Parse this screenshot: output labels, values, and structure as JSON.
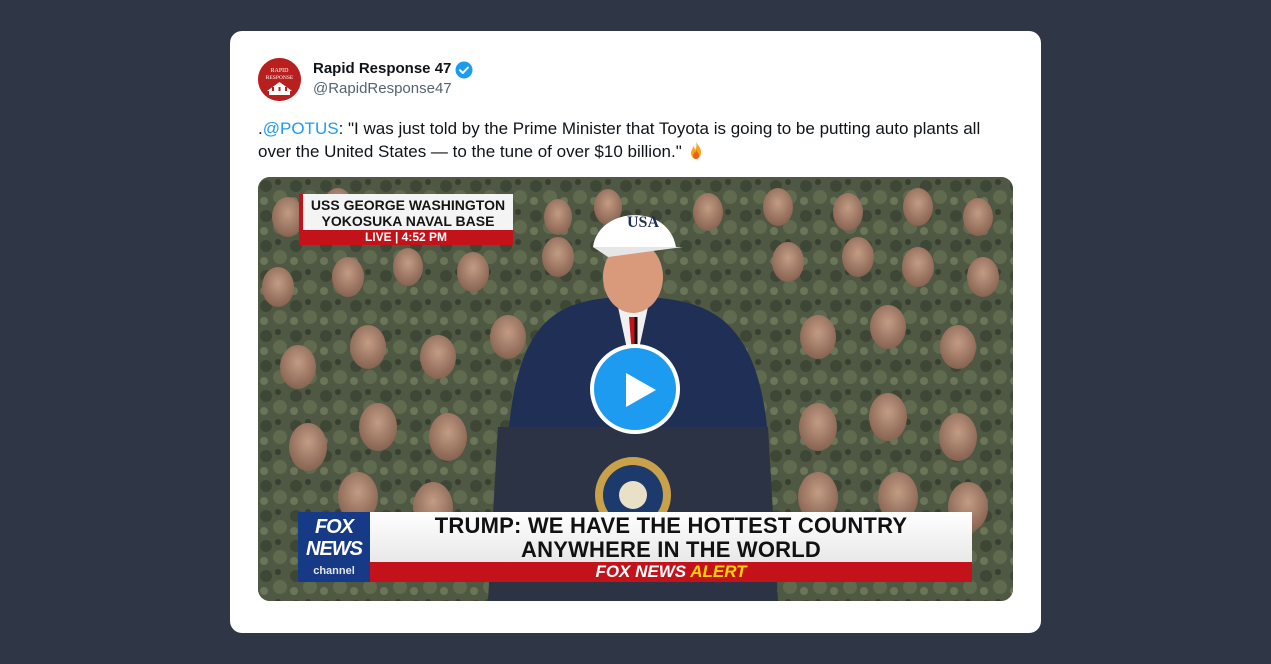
{
  "tweet": {
    "author": {
      "display_name": "Rapid Response 47",
      "handle": "@RapidResponse47",
      "avatar_text_line1": "RAPID",
      "avatar_text_line2": "RESPONSE",
      "verified": true
    },
    "text_prefix": ".",
    "mention": "@POTUS",
    "text_body": ": \"I was just told by the Prime Minister that Toyota is going to be putting auto plants all over the United States — to the tune of over $10 billion.\"",
    "emoji": "fire-emoji"
  },
  "video": {
    "location_line1": "USS GEORGE WASHINGTON",
    "location_line2": "YOKOSUKA NAVAL BASE",
    "live_label": "LIVE",
    "separator": "|",
    "time": "4:52 PM",
    "headline_line1": "TRUMP: WE HAVE THE HOTTEST COUNTRY",
    "headline_line2": "ANYWHERE IN THE WORLD",
    "alert_brand": "FOX NEWS",
    "alert_word": "ALERT",
    "logo_line1": "FOX",
    "logo_line2": "NEWS",
    "logo_line3": "channel",
    "cap_text": "USA",
    "play_icon": "play-icon"
  },
  "colors": {
    "background": "#2f3747",
    "card": "#ffffff",
    "link": "#1d9bf0",
    "play_button": "#1d9bf0",
    "fox_red": "#c4121a",
    "fox_blue": "#163a85"
  }
}
